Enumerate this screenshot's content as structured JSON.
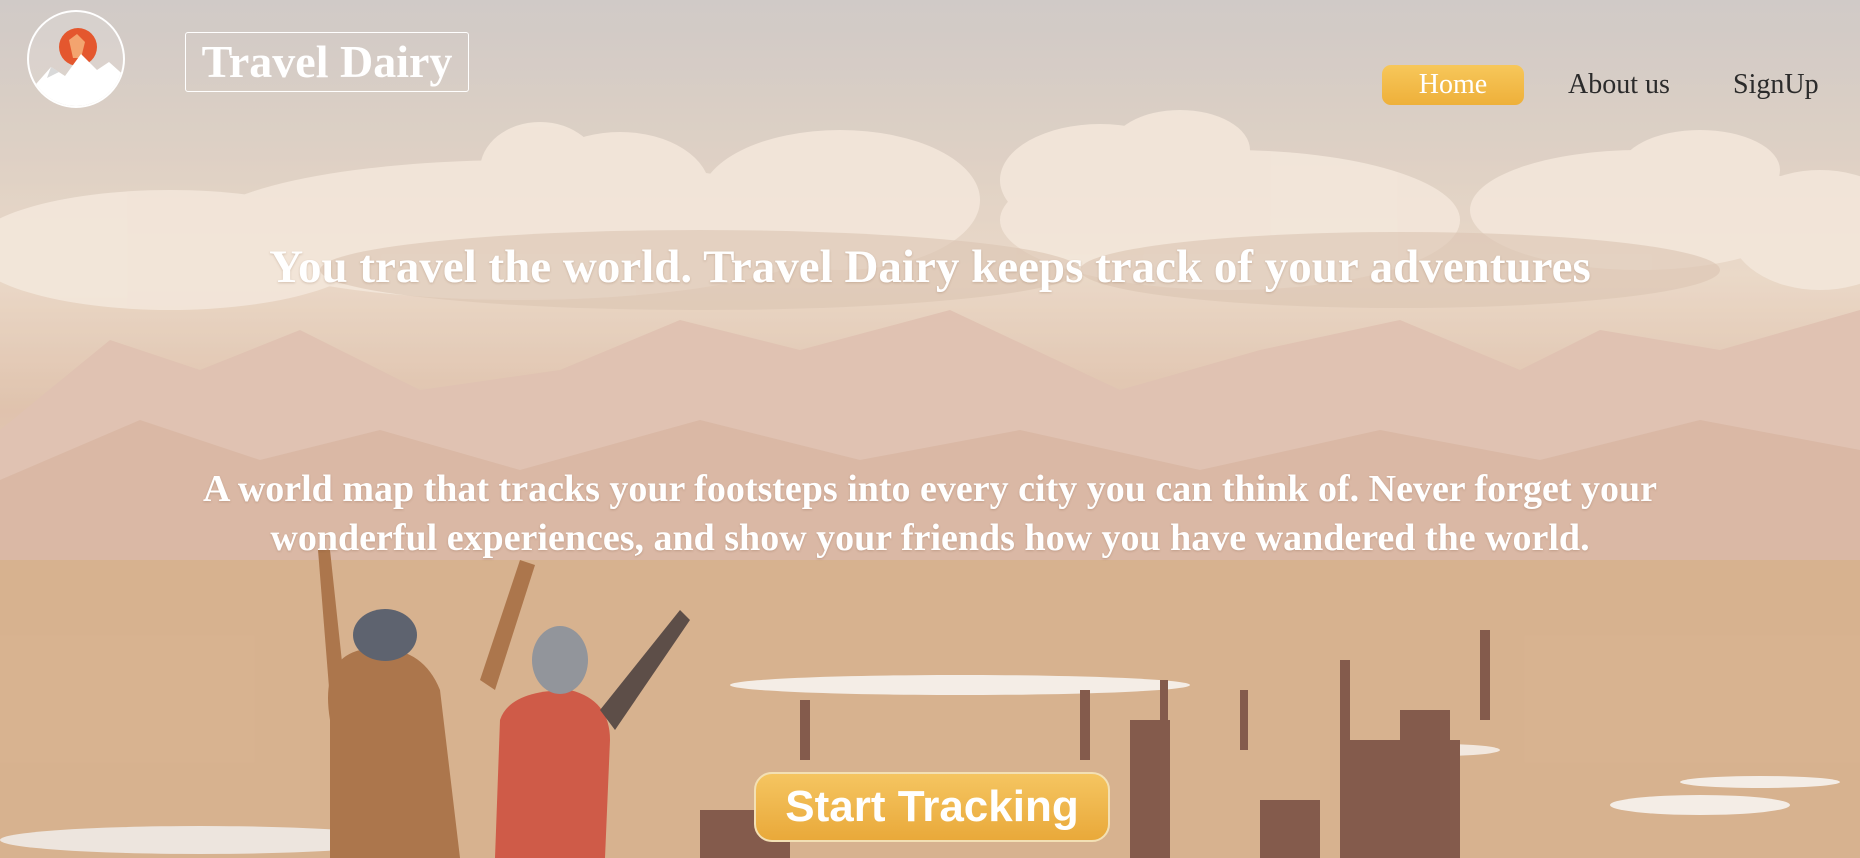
{
  "header": {
    "logo_icon": "mountain-hiker-logo",
    "brand": "Travel Dairy",
    "nav": {
      "home": "Home",
      "about": "About us",
      "signup": "SignUp"
    }
  },
  "hero": {
    "headline": "You travel the world. Travel Dairy keeps track of your adventures",
    "subhead_line1": "A world map that tracks your footsteps into every city you can think of. Never forget your",
    "subhead_line2": "wonderful experiences, and show your friends how you have wandered the world.",
    "cta": "Start Tracking"
  },
  "colors": {
    "accent": "#f2b94b",
    "text_light": "#ffffff",
    "nav_text": "#2b2b2b",
    "logo_sun": "#e4572e"
  }
}
